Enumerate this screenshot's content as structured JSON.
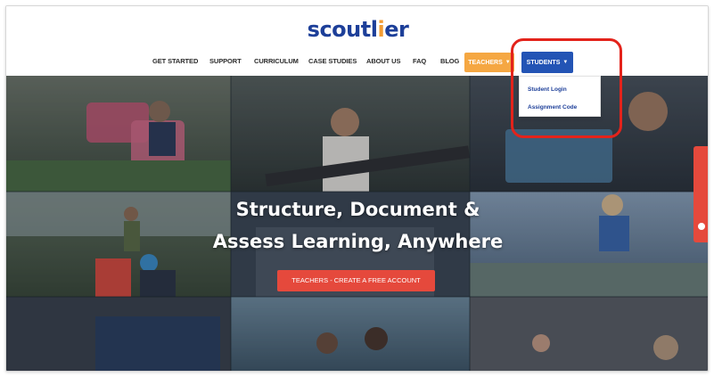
{
  "brand": {
    "logo_main": "scoutl",
    "logo_accent": "i",
    "logo_tail": "er",
    "logo_color": "#1d3f99",
    "accent_color": "#f39c32"
  },
  "nav": {
    "get_started": "GET STARTED",
    "support": "SUPPORT",
    "curriculum": "CURRICULUM",
    "case_studies": "CASE STUDIES",
    "about_us": "ABOUT US",
    "faq": "FAQ",
    "blog": "BLOG",
    "teachers": "TEACHERS",
    "students": "STUDENTS",
    "teachers_color": "#f5a742",
    "students_color": "#2354b5"
  },
  "students_menu": {
    "student_login": "Student Login",
    "assignment_code": "Assignment Code"
  },
  "hero": {
    "title_line1": "Structure, Document &",
    "title_line2": "Assess Learning, Anywhere",
    "cta_label": "TEACHERS - CREATE A FREE ACCOUNT",
    "cta_color": "#e5493c"
  },
  "highlight_color": "#e3231b"
}
